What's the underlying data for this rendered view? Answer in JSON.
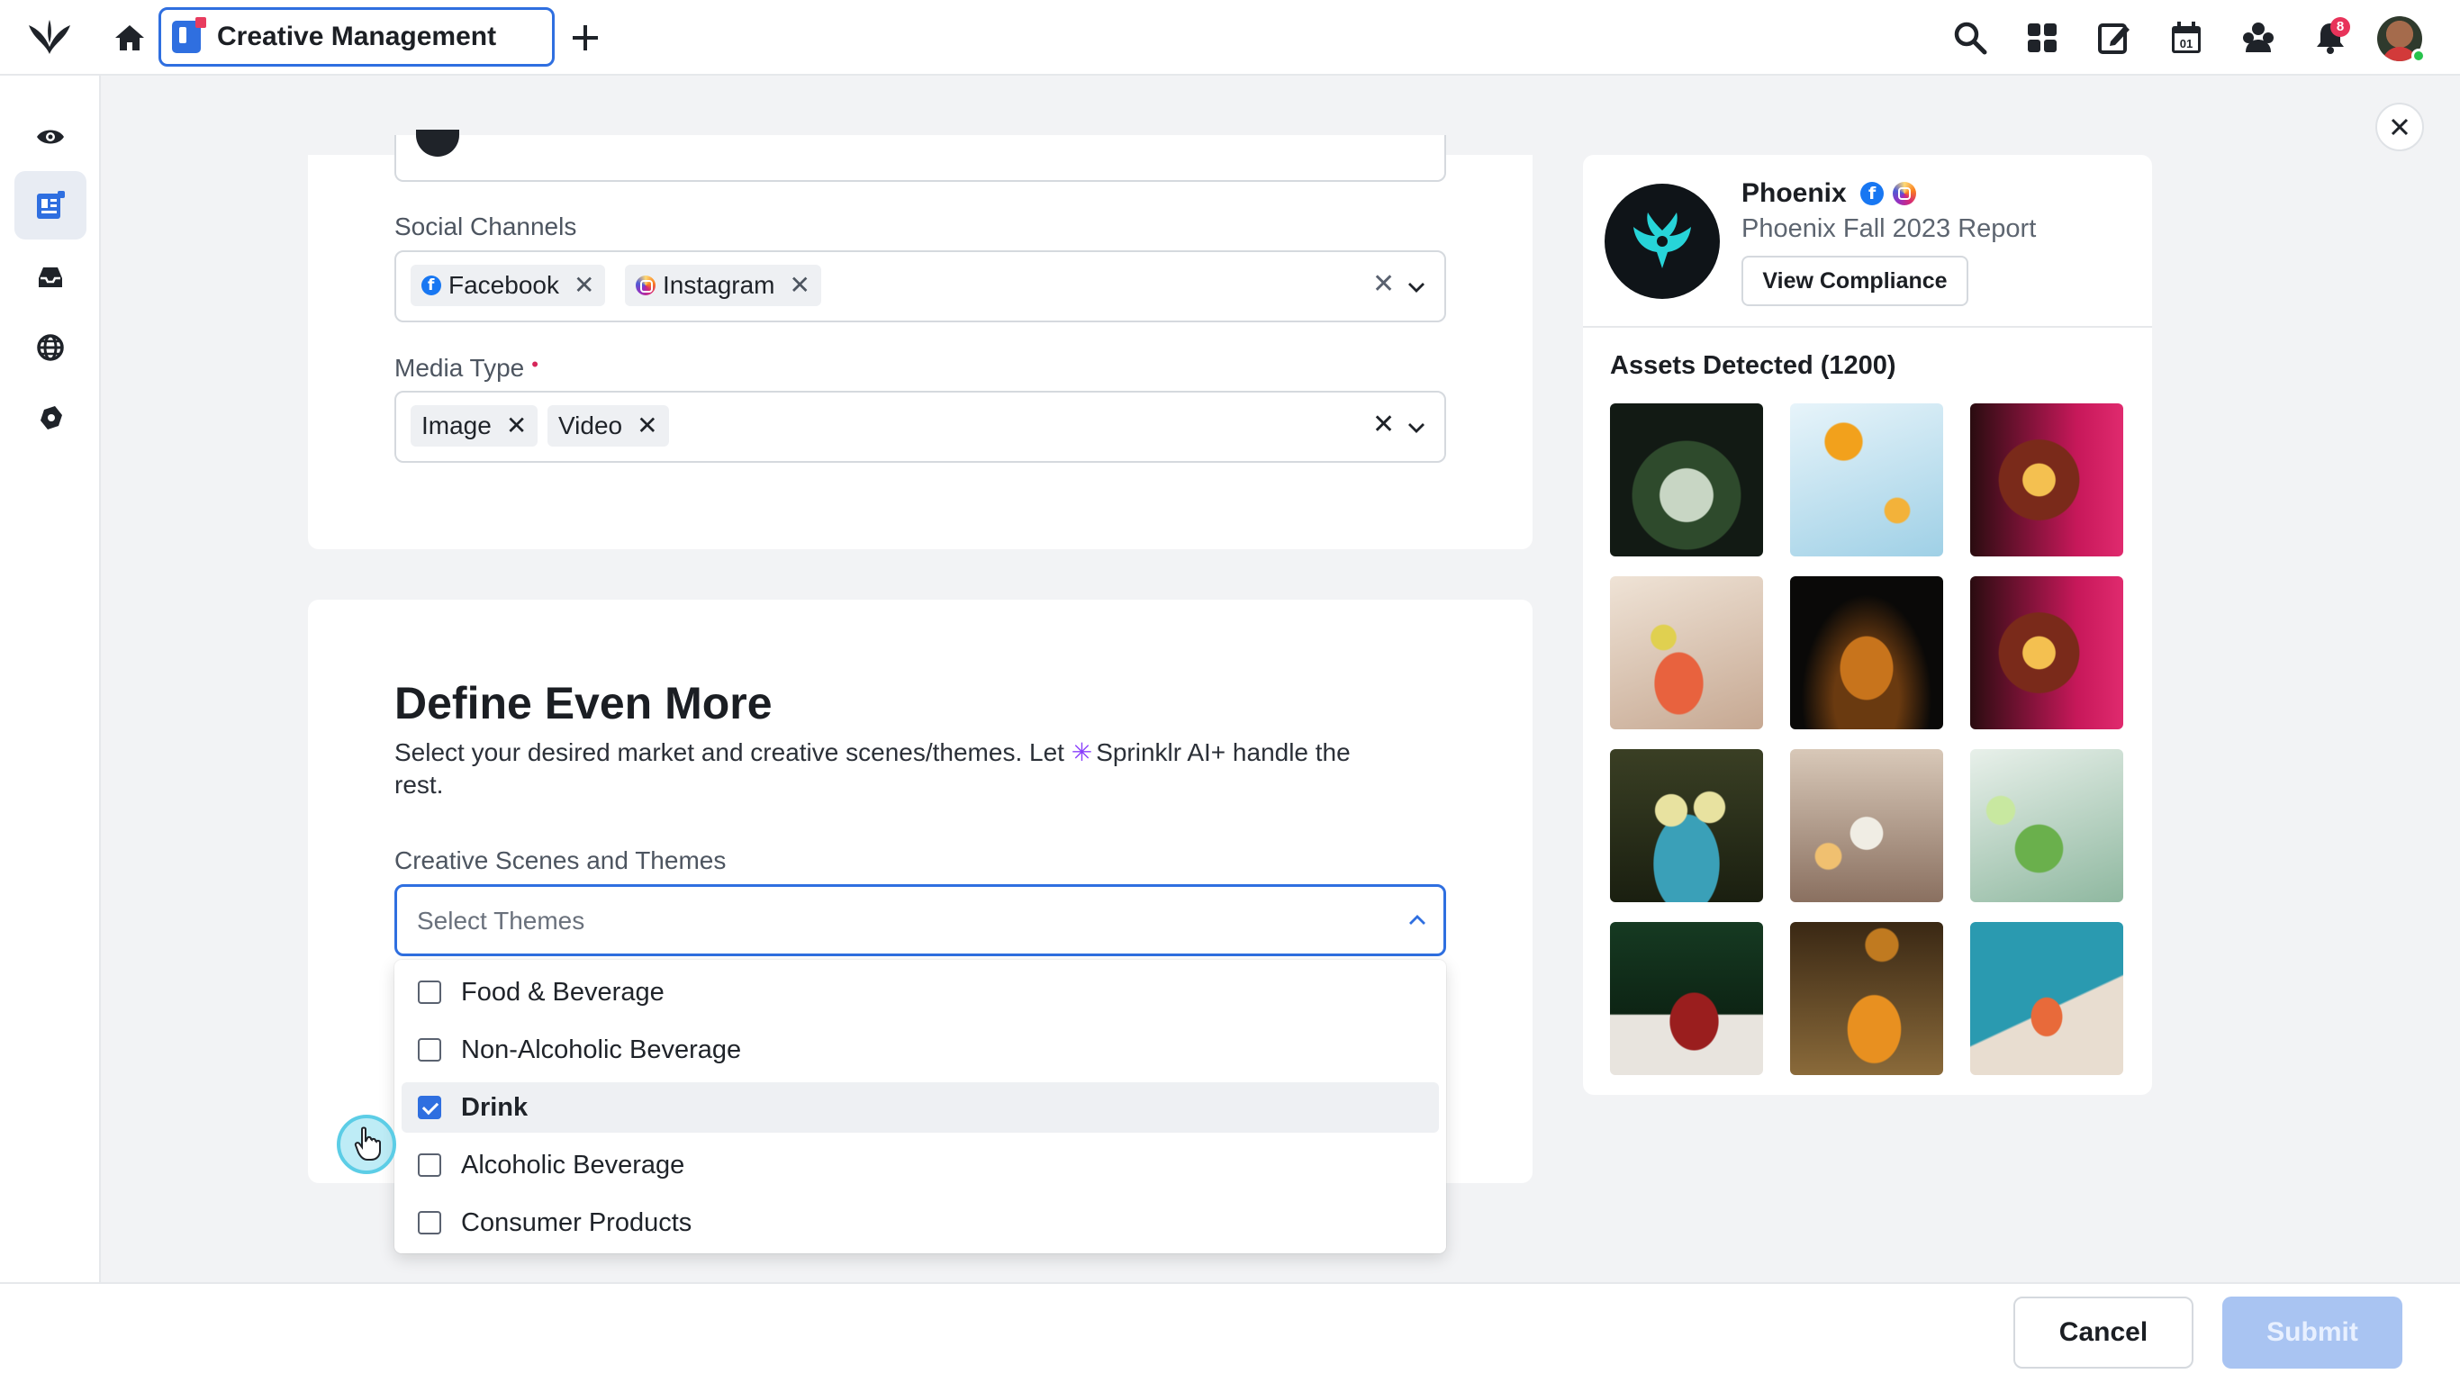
{
  "header": {
    "tab_title": "Creative Management",
    "notification_count": "8",
    "icons": [
      "sprinklr-logo-icon",
      "home-icon",
      "plus-icon",
      "search-icon",
      "apps-grid-icon",
      "compose-icon",
      "calendar-icon",
      "community-icon",
      "bell-icon"
    ],
    "calendar_day": "01"
  },
  "rail": {
    "items": [
      "eye-icon",
      "creative-doc-icon",
      "inbox-icon",
      "globe-icon",
      "settings-puzzle-icon"
    ]
  },
  "form": {
    "social_channels_label": "Social Channels",
    "social_channels": [
      "Facebook",
      "Instagram"
    ],
    "media_type_label": "Media Type",
    "media_types": [
      "Image",
      "Video"
    ],
    "required_marker": "•"
  },
  "define_more": {
    "title": "Define Even More",
    "description_before": "Select your desired market and creative scenes/themes. Let ",
    "ai_label": "Sprinklr AI+",
    "description_after": " handle the rest.",
    "themes_label": "Creative Scenes and Themes",
    "themes_placeholder": "Select Themes",
    "options": [
      {
        "label": "Food & Beverage",
        "checked": false
      },
      {
        "label": "Non-Alcoholic Beverage",
        "checked": false
      },
      {
        "label": "Drink",
        "checked": true
      },
      {
        "label": "Alcoholic Beverage",
        "checked": false
      },
      {
        "label": "Consumer Products",
        "checked": false
      }
    ]
  },
  "brand_panel": {
    "name": "Phoenix",
    "report": "Phoenix Fall 2023 Report",
    "compliance_button": "View Compliance",
    "assets_title": "Assets Detected (1200)",
    "assets": [
      "mojito-glass",
      "orange-splash",
      "wine-glass-neon",
      "citrus-cocktail",
      "whiskey-glass",
      "wine-glass-neon-2",
      "garnished-coupes",
      "pouring-martini",
      "lime-mint-glass",
      "red-highball",
      "pouring-whiskey",
      "orange-drink-teal"
    ]
  },
  "footer": {
    "cancel_label": "Cancel",
    "submit_label": "Submit"
  },
  "colors": {
    "accent": "#2f6fe0",
    "badge": "#e8335a",
    "submit_disabled": "#a9c4f2"
  }
}
